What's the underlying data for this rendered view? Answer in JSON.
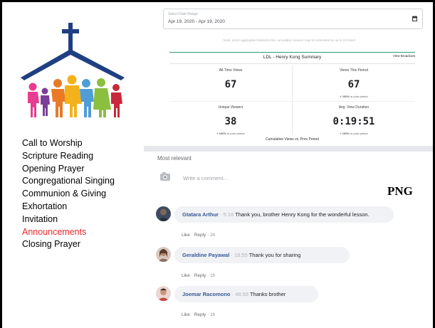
{
  "menu": {
    "items": [
      {
        "label": "Call to Worship"
      },
      {
        "label": "Scripture Reading"
      },
      {
        "label": "Opening Prayer"
      },
      {
        "label": "Congregational Singing"
      },
      {
        "label": "Communion & Giving"
      },
      {
        "label": "Exhortation"
      },
      {
        "label": "Invitation"
      },
      {
        "label": "Announcements",
        "active": true
      },
      {
        "label": "Closing Prayer"
      }
    ],
    "active_color": "#e8262a"
  },
  "screenshot": {
    "date_range": {
      "label": "Select Date Range",
      "value": "Apr 19, 2020 - Apr 19, 2020"
    },
    "note": "Note: some aggregated statistics like cumulative viewers may be estimated by up to 24 hours",
    "summary": {
      "title": "LDL - Henry Kong Summary",
      "link": "View Broadcast",
      "metrics": [
        {
          "label": "All-Time Views",
          "value": "67",
          "sub": "in prior period",
          "sub_prefix": "+ 100%"
        },
        {
          "label": "Views This Period",
          "value": "67",
          "sub": "in prior period",
          "sub_prefix": "+ 100%"
        },
        {
          "label": "Unique Viewers",
          "value": "38",
          "sub": "in prior period",
          "sub_prefix": "+ 100%"
        },
        {
          "label": "Avg. View Duration",
          "value": "0:19:51",
          "sub": "in prior period",
          "sub_prefix": "+ 100%"
        }
      ],
      "footer": "Cumulative Views vs. Prev Period",
      "accent": "#2a9a7c"
    },
    "comments_header": "Most relevant",
    "write_comment_placeholder": "Write a comment...",
    "png_label": "PNG",
    "comments": [
      {
        "author": "Gtatara Arthur",
        "time": "5:16",
        "text": "Thank you, brother Henry Kong for the wonderful lesson.",
        "like": "Like",
        "reply": "Reply",
        "age": "2h"
      },
      {
        "author": "Geraldine Payawal",
        "time": "18:55",
        "text": "Thank you for sharing",
        "like": "Like",
        "reply": "Reply",
        "age": "1h"
      },
      {
        "author": "Joemar Racomono",
        "time": "48:58",
        "text": "Thanks brother",
        "like": "Like",
        "reply": "Reply",
        "age": "1h"
      }
    ],
    "link_color": "#385898"
  }
}
